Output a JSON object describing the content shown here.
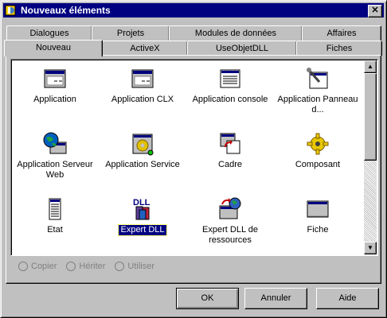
{
  "window": {
    "title": "Nouveaux éléments",
    "close": "✕"
  },
  "tabs_back": [
    "Dialogues",
    "Projets",
    "Modules de données",
    "Affaires"
  ],
  "tabs_front": [
    "Nouveau",
    "ActiveX",
    "UseObjetDLL",
    "Fiches"
  ],
  "active_tab": "Nouveau",
  "items": [
    {
      "label": "Application",
      "icon": "application-window-icon"
    },
    {
      "label": "Application CLX",
      "icon": "application-clx-window-icon"
    },
    {
      "label": "Application console",
      "icon": "console-lines-icon"
    },
    {
      "label": "Application Panneau d...",
      "icon": "control-panel-wrench-icon"
    },
    {
      "label": "Application Serveur Web",
      "icon": "globe-server-icon"
    },
    {
      "label": "Application Service",
      "icon": "gear-window-icon"
    },
    {
      "label": "Cadre",
      "icon": "frame-arrow-icon"
    },
    {
      "label": "Composant",
      "icon": "gear-yellow-icon"
    },
    {
      "label": "Etat",
      "icon": "report-page-icon"
    },
    {
      "label": "Expert DLL",
      "icon": "dll-icon",
      "selected": true
    },
    {
      "label": "Expert DLL de ressources",
      "icon": "dll-resources-globe-icon"
    },
    {
      "label": "Fiche",
      "icon": "blank-form-icon"
    }
  ],
  "options": [
    "Copier",
    "Hériter",
    "Utiliser"
  ],
  "buttons": {
    "ok": "OK",
    "cancel": "Annuler",
    "help": "Aide"
  }
}
